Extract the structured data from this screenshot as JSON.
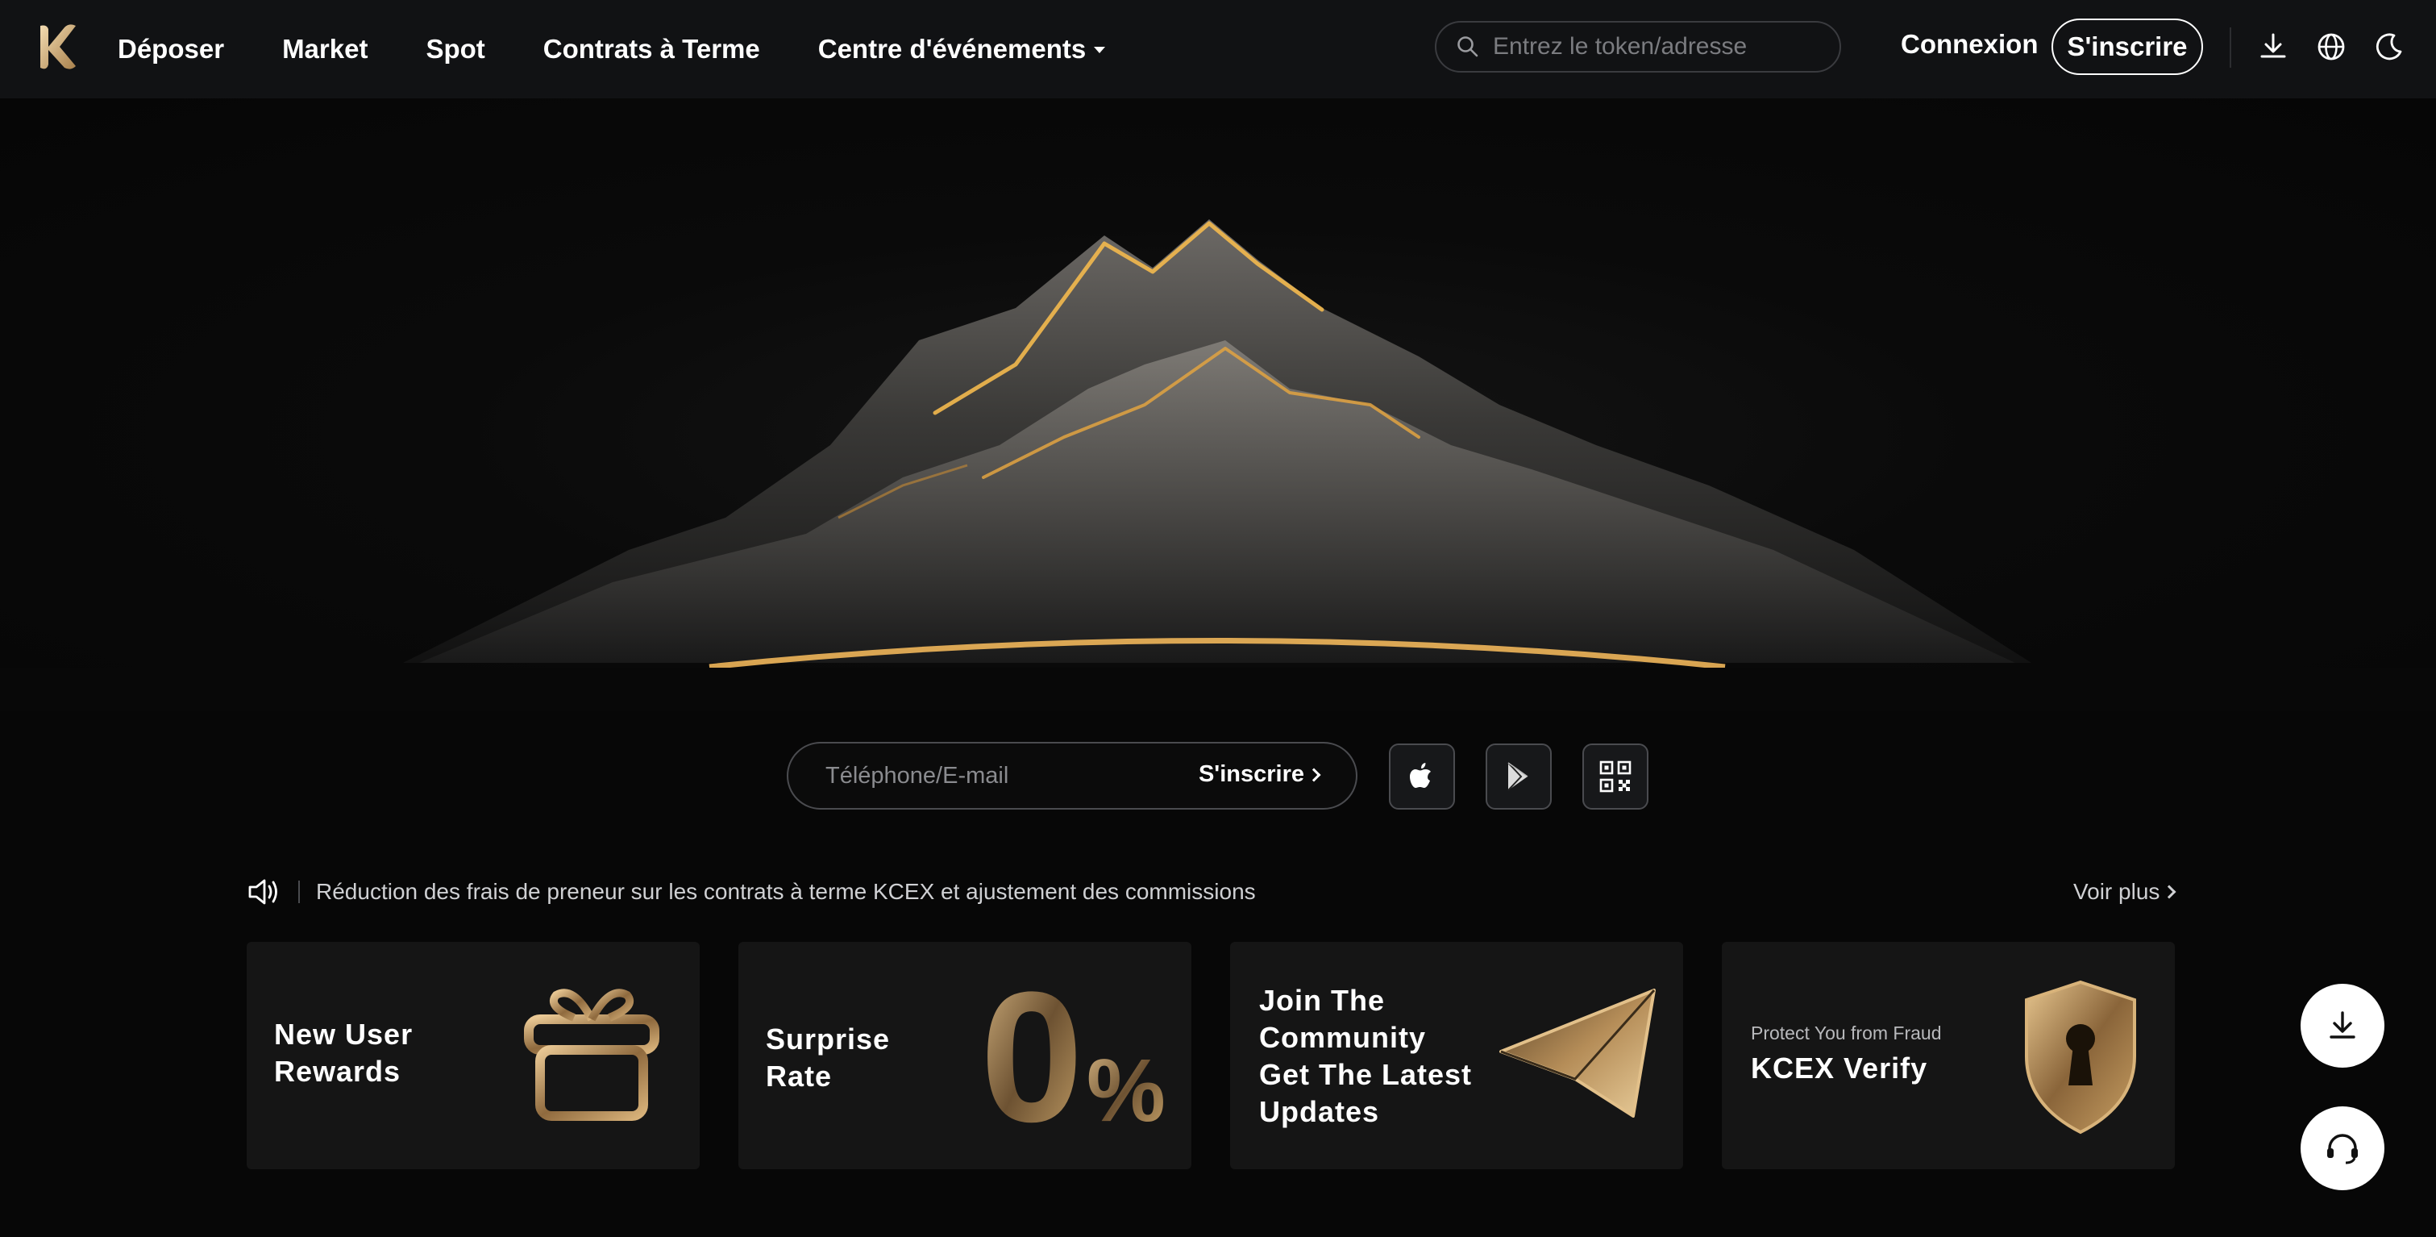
{
  "header": {
    "logo_icon": "kcex-k-logo",
    "nav": [
      {
        "label": "Déposer"
      },
      {
        "label": "Market"
      },
      {
        "label": "Spot"
      },
      {
        "label": "Contrats à Terme"
      },
      {
        "label": "Centre d'événements",
        "has_dropdown": true
      }
    ],
    "search": {
      "placeholder": "Entrez le token/adresse",
      "value": ""
    },
    "login_label": "Connexion",
    "signup_label": "S'inscrire",
    "icons": [
      "download-icon",
      "globe-icon",
      "moon-icon"
    ]
  },
  "hero": {
    "image": "golden-mountain-illustration",
    "signup_form": {
      "placeholder": "Téléphone/E-mail",
      "value": "",
      "submit_label": "S'inscrire"
    },
    "store_buttons": [
      "apple-icon",
      "google-play-icon",
      "qr-code-icon"
    ]
  },
  "announcement": {
    "icon": "speaker-icon",
    "text": "Réduction des frais de preneur sur les contrats à terme KCEX et ajustement des commissions",
    "more_label": "Voir plus"
  },
  "cards": [
    {
      "title_lines": [
        "New User",
        "Rewards"
      ],
      "icon": "gift-icon"
    },
    {
      "title_lines": [
        "Surprise",
        "Rate"
      ],
      "big_number": "0",
      "unit": "%",
      "icon": "zero-percent-icon"
    },
    {
      "title_lines": [
        "Join The",
        "Community",
        "Get The Latest",
        "Updates"
      ],
      "icon": "telegram-icon"
    },
    {
      "subtitle": "Protect You from Fraud",
      "title_lines": [
        "KCEX Verify"
      ],
      "icon": "shield-keyhole-icon"
    }
  ],
  "floating": [
    "download-icon",
    "headset-icon"
  ],
  "colors": {
    "background": "#070707",
    "header_bg": "#111214",
    "card_bg": "#151515",
    "accent_gold": "#c9a46a"
  }
}
